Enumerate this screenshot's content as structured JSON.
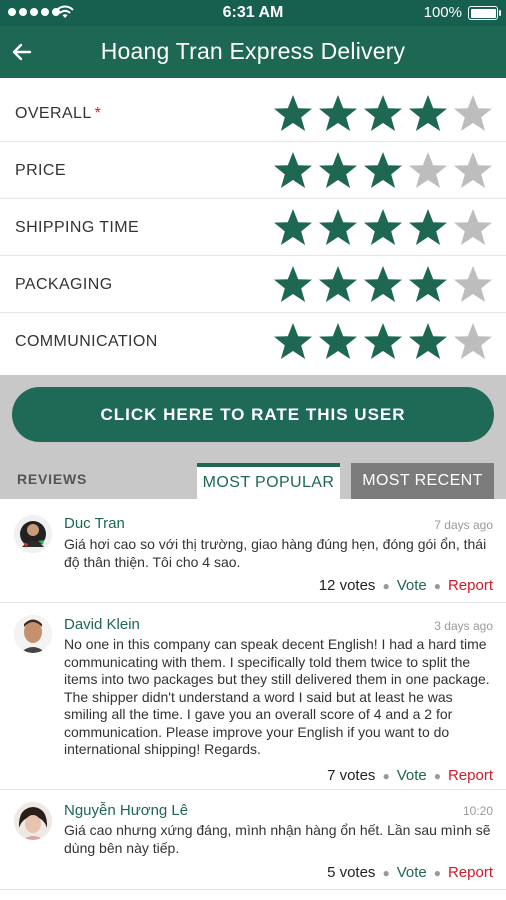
{
  "status_bar": {
    "time": "6:31 AM",
    "battery": "100%"
  },
  "app_bar": {
    "title": "Hoang Tran Express Delivery",
    "back_icon": "arrow-left-icon"
  },
  "ratings": [
    {
      "label": "OVERALL",
      "required_mark": "*",
      "value": 4,
      "max": 5
    },
    {
      "label": "PRICE",
      "required_mark": "",
      "value": 3,
      "max": 5
    },
    {
      "label": "SHIPPING TIME",
      "required_mark": "",
      "value": 4,
      "max": 5
    },
    {
      "label": "PACKAGING",
      "required_mark": "",
      "value": 4,
      "max": 5
    },
    {
      "label": "COMMUNICATION",
      "required_mark": "",
      "value": 4,
      "max": 5
    }
  ],
  "rate_button": {
    "label": "CLICK HERE TO RATE THIS USER"
  },
  "reviews_header": {
    "label": "REVIEWS",
    "tabs": [
      {
        "label": "MOST POPULAR",
        "active": true
      },
      {
        "label": "MOST RECENT",
        "active": false
      }
    ]
  },
  "reviews": [
    {
      "name": "Duc Tran",
      "time": "7 days ago",
      "text": "Giá hơi cao so với thị trường, giao hàng đúng hẹn, đóng gói ổn, thái độ thân thiện. Tôi cho 4 sao.",
      "votes": "12 votes",
      "vote_label": "Vote",
      "report_label": "Report"
    },
    {
      "name": "David Klein",
      "time": "3 days ago",
      "text": "No one in this company can speak decent English! I had a hard time communicating with them. I specifically told them twice to split the items into two packages but they still delivered them in one package. The shipper didn't understand a word I said but at least he was smiling all the time. I gave you an overall score of 4 and a 2 for communication. Please improve your English if you want to do international shipping! Regards.",
      "votes": "7 votes",
      "vote_label": "Vote",
      "report_label": "Report"
    },
    {
      "name": "Nguyễn Hương Lê",
      "time": "10:20",
      "text": "Giá cao nhưng xứng đáng, mình nhận hàng ổn hết. Lần sau mình sẽ dùng bên này tiếp.",
      "votes": "5 votes",
      "vote_label": "Vote",
      "report_label": "Report"
    }
  ],
  "colors": {
    "primary": "#1d6753",
    "star_filled": "#1d6753",
    "star_empty": "#bdbdbd",
    "report": "#d11a2a"
  }
}
